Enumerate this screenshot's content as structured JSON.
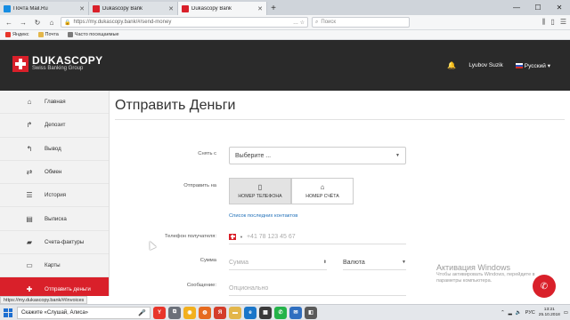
{
  "browser": {
    "tabs": [
      {
        "title": "Почта Mail.Ru",
        "color": "#168de2"
      },
      {
        "title": "Dukascopy Bank",
        "color": "#d9202a"
      },
      {
        "title": "Dukascopy Bank",
        "color": "#d9202a",
        "active": true
      }
    ],
    "new_tab": "+",
    "url": "https://my.dukascopy.bank/#/send-money",
    "search_placeholder": "Поиск",
    "bookmarks": [
      "Яндекс",
      "Почта",
      "Часто посещаемые"
    ]
  },
  "header": {
    "logo_name": "DUKASCOPY",
    "logo_sub": "Swiss Banking Group",
    "user": "Lyubov Suzik",
    "language": "Русский"
  },
  "sidebar": {
    "items": [
      {
        "label": "Главная",
        "icon": "home-icon",
        "glyph": "⌂"
      },
      {
        "label": "Депозит",
        "icon": "share-icon",
        "glyph": "↱"
      },
      {
        "label": "Вывод",
        "icon": "reply-icon",
        "glyph": "↰"
      },
      {
        "label": "Обмен",
        "icon": "exchange-icon",
        "glyph": "⇄"
      },
      {
        "label": "История",
        "icon": "list-icon",
        "glyph": "☰"
      },
      {
        "label": "Выписка",
        "icon": "table-icon",
        "glyph": "▤"
      },
      {
        "label": "Счета-фактуры",
        "icon": "folder-icon",
        "glyph": "▰"
      },
      {
        "label": "Карты",
        "icon": "card-icon",
        "glyph": "▭"
      },
      {
        "label": "Отправить деньги",
        "icon": "send-icon",
        "glyph": "✚",
        "active": true
      }
    ]
  },
  "main": {
    "title": "Отправить Деньги",
    "from_label": "Снять с",
    "from_value": "Выберите ...",
    "send_to_label": "Отправить на",
    "send_to_options": [
      "НОМЕР ТЕЛЕФОНА",
      "НОМЕР СЧЁТА"
    ],
    "contacts_link": "Список последних контактов",
    "recipient_phone_label": "Телефон получателя:",
    "phone_placeholder": "+41 78 123 45 67",
    "amount_label": "Сумма",
    "amount_placeholder": "Сумма",
    "currency_value": "Валюта",
    "message_label": "Сообщение:",
    "message_placeholder": "Опционально"
  },
  "overlay": {
    "watermark_title": "Активация Windows",
    "watermark_line1": "Чтобы активировать Windows, перейдите в",
    "watermark_line2": "параметры компьютера.",
    "status_url": "https://my.dukascopy.bank/#/invoices"
  },
  "taskbar": {
    "search_text": "Скажите «Слушай, Алиса»",
    "time": "13:21",
    "date": "25.10.2018",
    "lang": "РУС"
  }
}
